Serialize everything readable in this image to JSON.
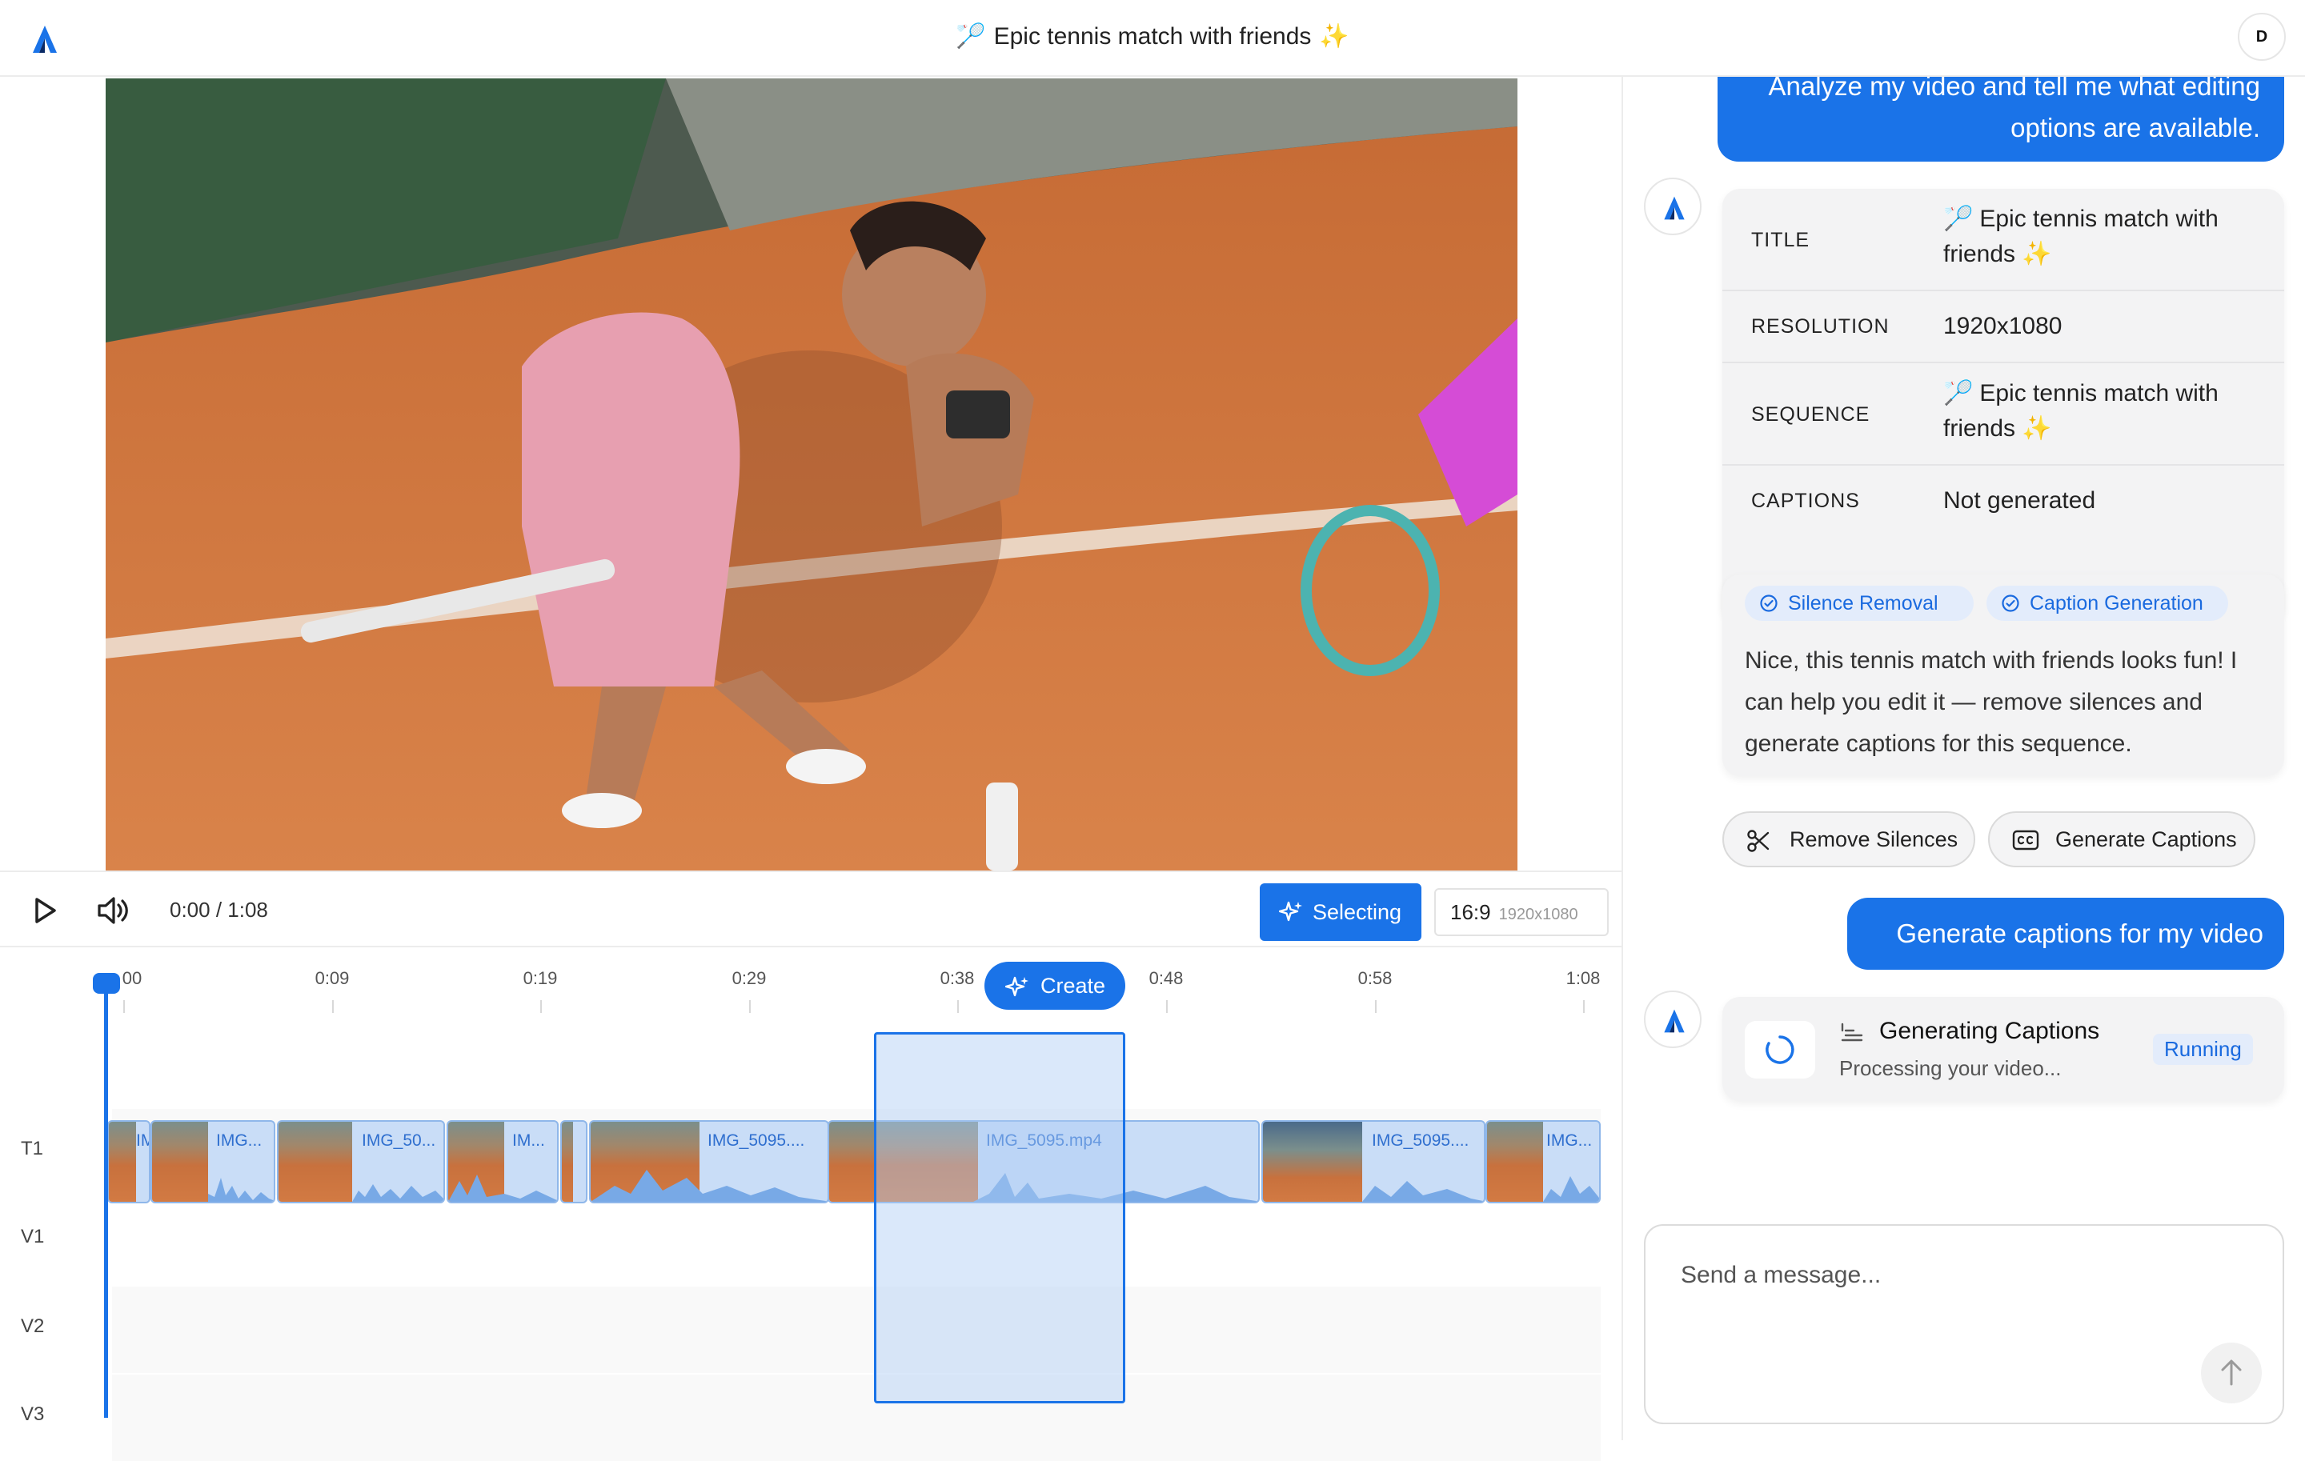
{
  "header": {
    "title": "Epic tennis match with friends",
    "title_emoji": "🏸",
    "title_spark": "✨",
    "avatar_initial": "D"
  },
  "player": {
    "time": "0:00 / 1:08",
    "selecting_label": "Selecting",
    "aspect_ratio": "16:9",
    "aspect_resolution": "1920x1080"
  },
  "timeline": {
    "ticks": [
      "00",
      "0:09",
      "0:19",
      "0:29",
      "0:38",
      "0:48",
      "0:58",
      "1:08"
    ],
    "tracks": [
      "T1",
      "V1",
      "V2",
      "V3"
    ],
    "create_label": "Create",
    "clips": [
      "IM",
      "IMG...",
      "IMG_50...",
      "IM...",
      "IMG_5095....",
      "IMG_5095.mp4",
      "IMG_5095....",
      "IMG..."
    ]
  },
  "chat": {
    "user_message_1": "Analyze my video and tell me what editing options are available.",
    "info": {
      "title_key": "TITLE",
      "title_value": "Epic tennis match with friends",
      "resolution_key": "RESOLUTION",
      "resolution_value": "1920x1080",
      "sequence_key": "SEQUENCE",
      "sequence_value": "Epic tennis match with friends",
      "captions_key": "CAPTIONS",
      "captions_value": "Not generated"
    },
    "chips": [
      "Silence Removal",
      "Caption Generation"
    ],
    "assistant_message": "Nice, this tennis match with friends looks fun! I can help you edit it — remove silences and generate captions for this sequence.",
    "actions": [
      "Remove Silences",
      "Generate Captions"
    ],
    "user_message_2": "Generate captions for my video",
    "task": {
      "title": "Generating Captions",
      "subtitle": "Processing your video...",
      "status": "Running"
    },
    "composer_placeholder": "Send a message..."
  },
  "colors": {
    "accent": "#1a73e8",
    "clip_fill": "#c9ddf7",
    "chip_bg": "#e3ecfb"
  }
}
